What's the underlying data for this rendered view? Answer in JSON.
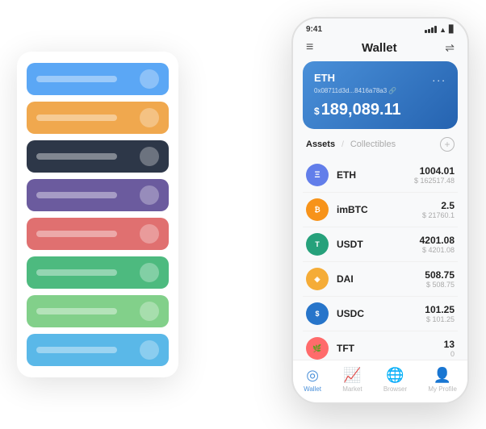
{
  "phone": {
    "status": {
      "time": "9:41",
      "signal_bars": [
        3,
        5,
        7,
        9
      ],
      "wifi": "▲",
      "battery": "▊"
    },
    "header": {
      "title": "Wallet",
      "menu_label": "≡",
      "expand_label": "⇌"
    },
    "eth_card": {
      "title": "ETH",
      "dots": "...",
      "address": "0x08711d3d...8416a78a3 🔗",
      "currency": "$",
      "amount": "189,089.11"
    },
    "assets": {
      "active_tab": "Assets",
      "separator": "/",
      "inactive_tab": "Collectibles",
      "add_button": "+"
    },
    "asset_list": [
      {
        "name": "ETH",
        "icon": "Ξ",
        "icon_class": "eth-coin",
        "amount": "1004.01",
        "usd": "$ 162517.48"
      },
      {
        "name": "imBTC",
        "icon": "₿",
        "icon_class": "imbtc-coin",
        "amount": "2.5",
        "usd": "$ 21760.1"
      },
      {
        "name": "USDT",
        "icon": "T",
        "icon_class": "usdt-coin",
        "amount": "4201.08",
        "usd": "$ 4201.08"
      },
      {
        "name": "DAI",
        "icon": "◈",
        "icon_class": "dai-coin",
        "amount": "508.75",
        "usd": "$ 508.75"
      },
      {
        "name": "USDC",
        "icon": "$",
        "icon_class": "usdc-coin",
        "amount": "101.25",
        "usd": "$ 101.25"
      },
      {
        "name": "TFT",
        "icon": "🌿",
        "icon_class": "tft-coin",
        "amount": "13",
        "usd": "0"
      }
    ],
    "nav": [
      {
        "id": "wallet",
        "label": "Wallet",
        "icon": "◎",
        "active": true
      },
      {
        "id": "market",
        "label": "Market",
        "icon": "📊",
        "active": false
      },
      {
        "id": "browser",
        "label": "Browser",
        "icon": "🌐",
        "active": false
      },
      {
        "id": "profile",
        "label": "My Profile",
        "icon": "👤",
        "active": false
      }
    ]
  },
  "card_stack": {
    "cards": [
      {
        "color_class": "card-blue"
      },
      {
        "color_class": "card-orange"
      },
      {
        "color_class": "card-dark"
      },
      {
        "color_class": "card-purple"
      },
      {
        "color_class": "card-red"
      },
      {
        "color_class": "card-green"
      },
      {
        "color_class": "card-light-green"
      },
      {
        "color_class": "card-sky"
      }
    ]
  }
}
